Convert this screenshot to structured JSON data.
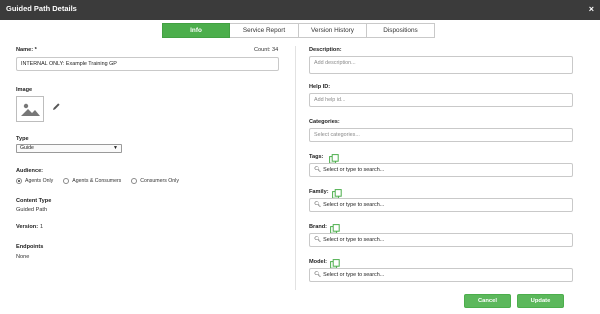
{
  "window": {
    "title": "Guided Path Details",
    "close_glyph": "×"
  },
  "tabs": [
    {
      "label": "Info",
      "active": true
    },
    {
      "label": "Service Report",
      "active": false
    },
    {
      "label": "Version History",
      "active": false
    },
    {
      "label": "Dispositions",
      "active": false
    }
  ],
  "left": {
    "name_label": "Name: *",
    "count_label": "Count: 34",
    "name_value": "INTERNAL ONLY: Example Training GP",
    "image_label": "Image",
    "type_label": "Type",
    "type_value": "Guide",
    "audience_label": "Audience:",
    "audience_options": [
      {
        "label": "Agents Only",
        "selected": true
      },
      {
        "label": "Agents & Consumers",
        "selected": false
      },
      {
        "label": "Consumers Only",
        "selected": false
      }
    ],
    "content_type_label": "Content Type",
    "content_type_value": "Guided Path",
    "version_label": "Version:",
    "version_value": "1",
    "endpoints_label": "Endpoints",
    "endpoints_value": "None"
  },
  "right": {
    "description_label": "Description:",
    "description_placeholder": "Add description...",
    "help_id_label": "Help ID:",
    "help_id_placeholder": "Add help id...",
    "categories_label": "Categories:",
    "categories_placeholder": "Select categories...",
    "tags_label": "Tags:",
    "family_label": "Family:",
    "brand_label": "Brand:",
    "model_label": "Model:",
    "search_placeholder": "Select or type to search..."
  },
  "footer": {
    "cancel_label": "Cancel",
    "update_label": "Update"
  },
  "colors": {
    "titlebar": "#3b3b3b",
    "accent_green": "#5cb85c",
    "copy_icon_green": "#4cae4c"
  },
  "icons": {
    "close": "close-icon",
    "image_placeholder": "image-icon",
    "edit": "pencil-icon",
    "copy": "copy-icon",
    "search": "search-icon",
    "caret": "caret-down-icon"
  }
}
